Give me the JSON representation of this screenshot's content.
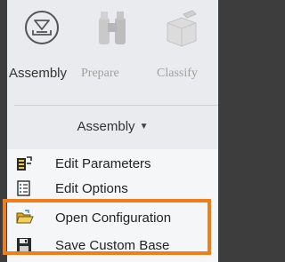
{
  "ribbon": {
    "buttons": [
      {
        "label": "Assembly",
        "icon": "assembly-icon",
        "enabled": true
      },
      {
        "label": "Prepare",
        "icon": "binoculars-icon",
        "enabled": false
      },
      {
        "label": "Classify",
        "icon": "classify-icon",
        "enabled": false
      }
    ],
    "group_title": "Assembly",
    "group_caret": "▼"
  },
  "menu": {
    "items": [
      {
        "label": "Edit Parameters",
        "icon": "edit-parameters-icon"
      },
      {
        "label": "Edit Options",
        "icon": "edit-options-icon"
      },
      {
        "label": "Open Configuration",
        "icon": "open-folder-icon"
      },
      {
        "label": "Save Custom Base",
        "icon": "save-icon"
      }
    ]
  },
  "highlight_color": "#ef7d1a"
}
